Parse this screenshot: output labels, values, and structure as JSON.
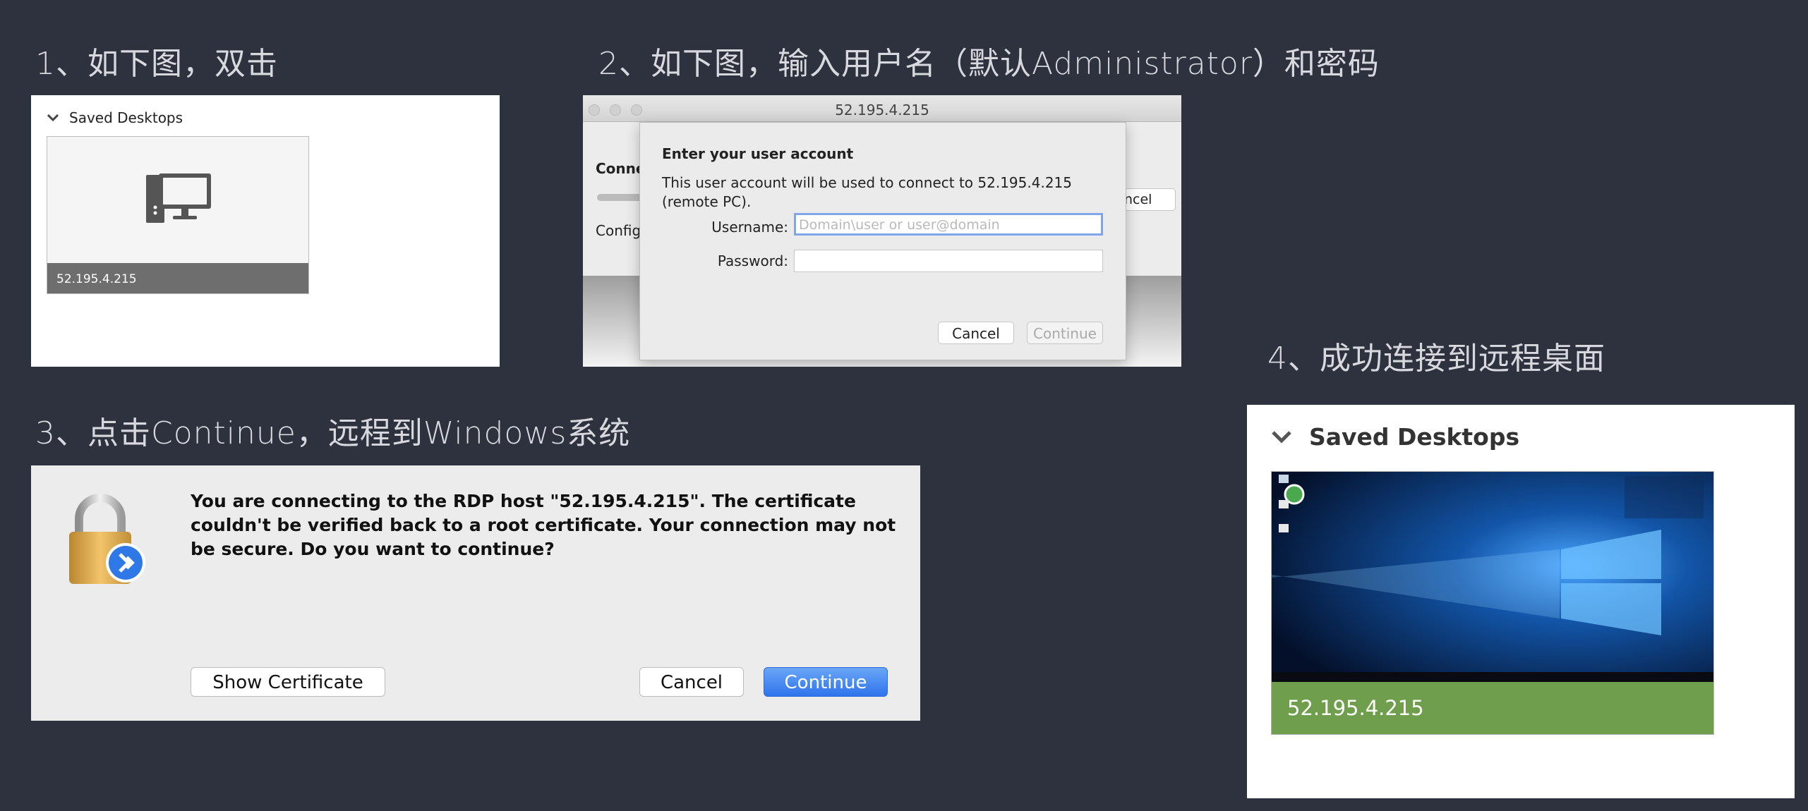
{
  "steps": {
    "s1": "1、如下图，双击",
    "s2": "2、如下图，输入用户名（默认Administrator）和密码",
    "s3": "3、点击Continue，远程到Windows系统",
    "s4": "4、成功连接到远程桌面"
  },
  "panel1": {
    "header": "Saved Desktops",
    "tile_label": "52.195.4.215",
    "icons": [
      "chevron-down-icon",
      "remote-desktop-icon"
    ]
  },
  "panel2": {
    "window_title": "52.195.4.215",
    "bg_connecting": "Conne",
    "bg_config": "Config",
    "bg_cancel": "ncel",
    "dialog": {
      "title": "Enter your user account",
      "description": "This user account will be used to connect to 52.195.4.215 (remote PC).",
      "username_label": "Username:",
      "username_placeholder": "Domain\\user or user@domain",
      "password_label": "Password:",
      "cancel": "Cancel",
      "continue": "Continue"
    }
  },
  "panel3": {
    "message": "You are connecting to the RDP host \"52.195.4.215\". The certificate couldn't be verified back to a root certificate. Your connection may not be secure. Do you want to continue?",
    "show_certificate": "Show Certificate",
    "cancel": "Cancel",
    "continue": "Continue",
    "icons": [
      "lock-icon",
      "remote-desktop-badge-icon"
    ]
  },
  "panel4": {
    "header": "Saved Desktops",
    "tile_label": "52.195.4.215",
    "tile_color": "#6f9f4c",
    "icons": [
      "chevron-down-icon",
      "windows-desktop-thumbnail"
    ]
  },
  "colors": {
    "background": "#2e313e",
    "primary_button": "#2f74ec",
    "focus_ring": "#7ea6e8"
  }
}
